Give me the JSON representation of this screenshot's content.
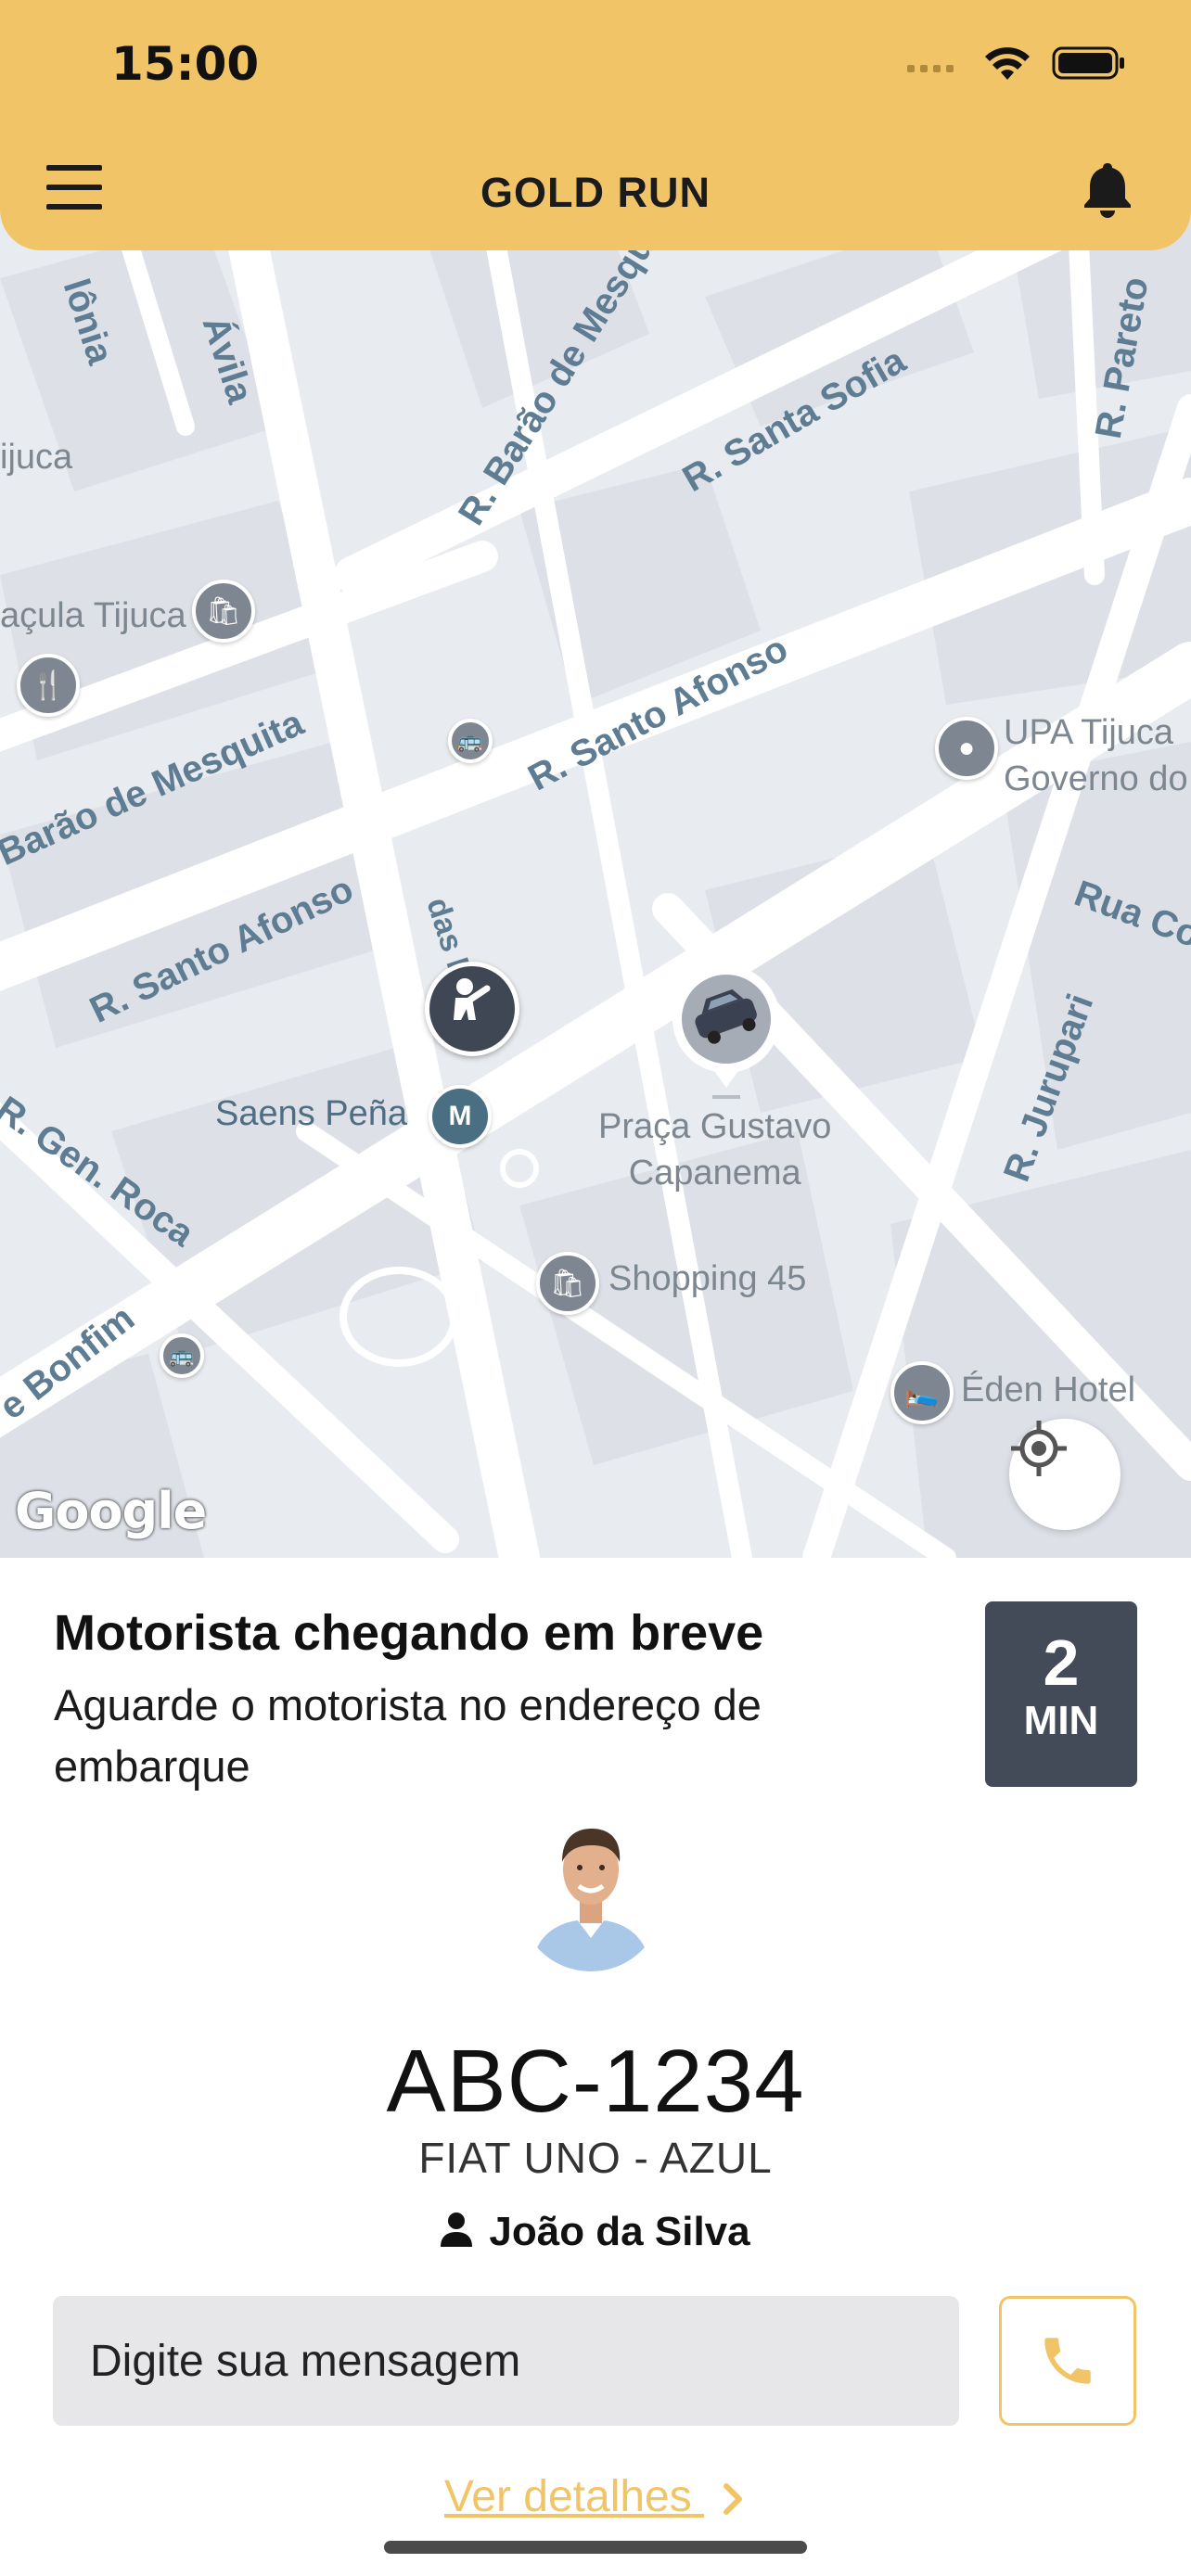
{
  "status_bar": {
    "time": "15:00"
  },
  "header": {
    "title": "GOLD RUN"
  },
  "map": {
    "streets": [
      "R. Barão de Mesquita",
      "R. Santa Sofia",
      "R. Pareto",
      "R. Santo Afonso",
      "Barão de Mesquita",
      "R. Santo Afonso",
      "das Flores",
      "R. Gen. Roca",
      "e Bonfim",
      "Rua Co",
      "R. Jurupari",
      "Ávila",
      "lônia",
      "ijuca"
    ],
    "pois": {
      "upa": "UPA Tijuca\nGoverno do",
      "tijuca": "açula Tijuca",
      "metro": "Saens Peña",
      "praca": "Praça Gustavo\nCapanema",
      "shopping": "Shopping 45",
      "hotel": "Éden Hotel"
    },
    "attribution": "Google"
  },
  "trip_status": {
    "title": "Motorista chegando em breve",
    "subtitle": "Aguarde o motorista no endereço de embarque"
  },
  "eta": {
    "value": "2",
    "unit": "MIN"
  },
  "vehicle": {
    "plate": "ABC-1234",
    "description": "FIAT UNO - AZUL"
  },
  "driver": {
    "name": "João da Silva"
  },
  "message": {
    "placeholder": "Digite sua mensagem"
  },
  "details_link": "Ver detalhes",
  "colors": {
    "accent": "#F1C567",
    "dark": "#434A58",
    "map_bg": "#E8EBEF"
  }
}
